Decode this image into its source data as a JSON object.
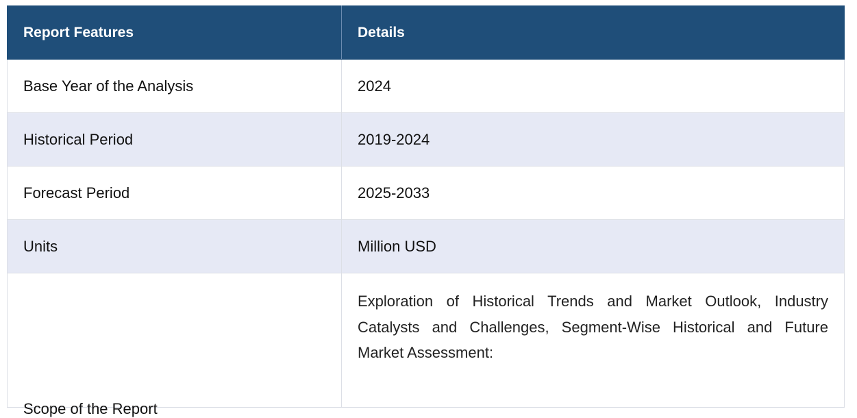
{
  "table": {
    "headers": [
      "Report Features",
      "Details"
    ],
    "rows": [
      {
        "feature": "Base Year of the Analysis",
        "detail": "2024"
      },
      {
        "feature": "Historical Period",
        "detail": "2019-2024"
      },
      {
        "feature": "Forecast Period",
        "detail": "2025-2033"
      },
      {
        "feature": "Units",
        "detail": "Million USD"
      },
      {
        "feature": "Scope of the Report",
        "detail": "Exploration of Historical Trends and Market Outlook, Industry Catalysts and Challenges, Segment-Wise Historical and Future Market Assessment:"
      }
    ]
  },
  "colors": {
    "header_bg": "#1f4e79",
    "header_text": "#ffffff",
    "alt_row_bg": "#e6e9f5",
    "border": "#dcdfe6"
  }
}
